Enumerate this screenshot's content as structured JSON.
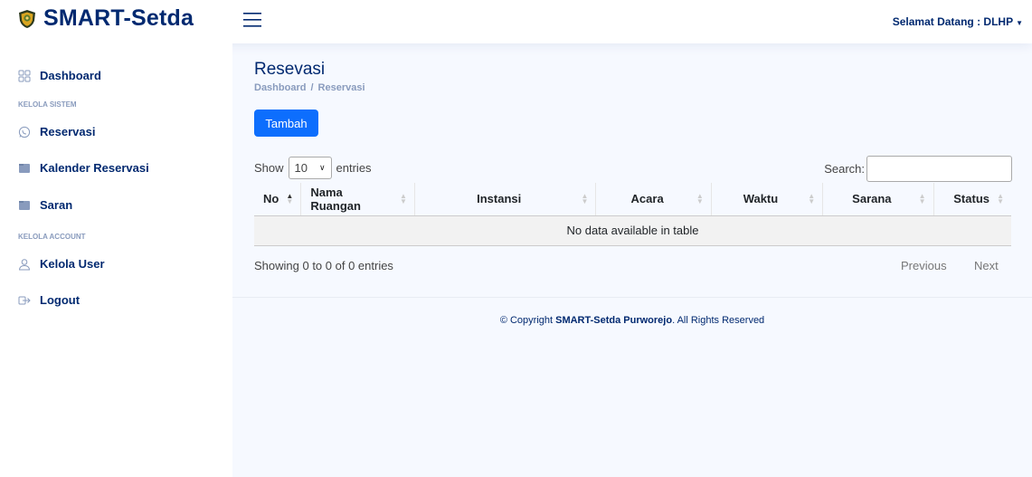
{
  "brand": {
    "name": "SMART-Setda"
  },
  "header": {
    "greeting": "Selamat Datang : DLHP"
  },
  "sidebar": {
    "dashboard": "Dashboard",
    "heading_sistem": "KELOLA SISTEM",
    "reservasi": "Reservasi",
    "kalender": "Kalender Reservasi",
    "saran": "Saran",
    "heading_account": "KELOLA ACCOUNT",
    "kelola_user": "Kelola User",
    "logout": "Logout"
  },
  "page": {
    "title": "Resevasi",
    "breadcrumb": {
      "home": "Dashboard",
      "separator": "/",
      "current": "Reservasi"
    },
    "add_button": "Tambah"
  },
  "table_controls": {
    "show_label": "Show",
    "length_value": "10",
    "entries_label": "entries",
    "search_label": "Search:"
  },
  "table": {
    "columns": [
      "No",
      "Nama Ruangan",
      "Instansi",
      "Acara",
      "Waktu",
      "Sarana",
      "Status"
    ],
    "empty_message": "No data available in table"
  },
  "pagination": {
    "info": "Showing 0 to 0 of 0 entries",
    "previous": "Previous",
    "next": "Next"
  },
  "footer": {
    "prefix": "© Copyright ",
    "brand": "SMART-Setda Purworejo",
    "suffix": ". All Rights Reserved"
  },
  "colors": {
    "primary": "#0d6efd",
    "navy": "#012970",
    "muted": "#899bbd"
  }
}
